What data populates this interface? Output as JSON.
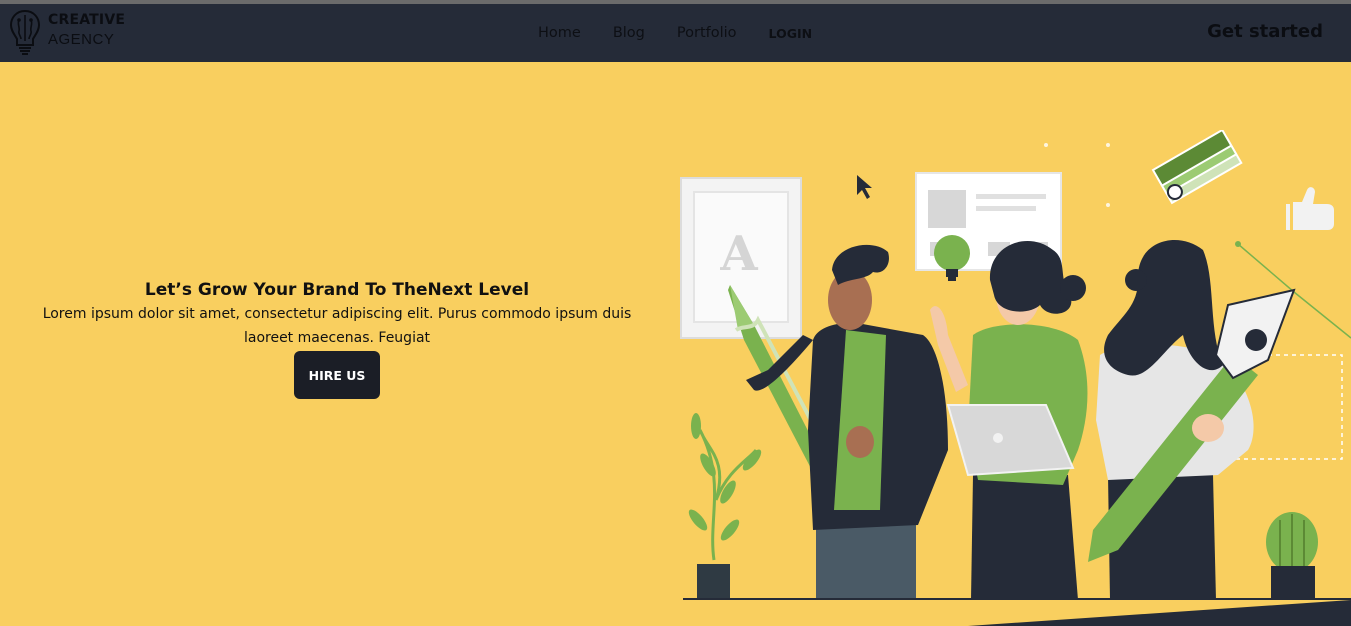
{
  "brand": {
    "line1": "CREATIVE",
    "line2": "AGENCY"
  },
  "nav": {
    "links": [
      {
        "label": "Home"
      },
      {
        "label": "Blog"
      },
      {
        "label": "Portfolio"
      }
    ],
    "login_label": "LOGIN",
    "cta_label": "Get started"
  },
  "hero": {
    "title": "Let’s Grow Your Brand To TheNext Level",
    "body": "Lorem ipsum dolor sit amet, consectetur adipiscing elit. Purus commodo ipsum duis laoreet maecenas. Feugiat",
    "button_label": "HIRE US"
  },
  "illustration": {
    "letter_card": "A"
  },
  "colors": {
    "navbar": "#252b38",
    "hero_background": "#f9cf5f",
    "accent_green": "#7ab24e",
    "button": "#1b1e26"
  },
  "icons": [
    "lightbulb-brain-logo-icon",
    "cursor-arrow-icon",
    "thumbs-up-icon",
    "lightbulb-icon",
    "color-swatch-icon",
    "pen-nib-icon"
  ]
}
